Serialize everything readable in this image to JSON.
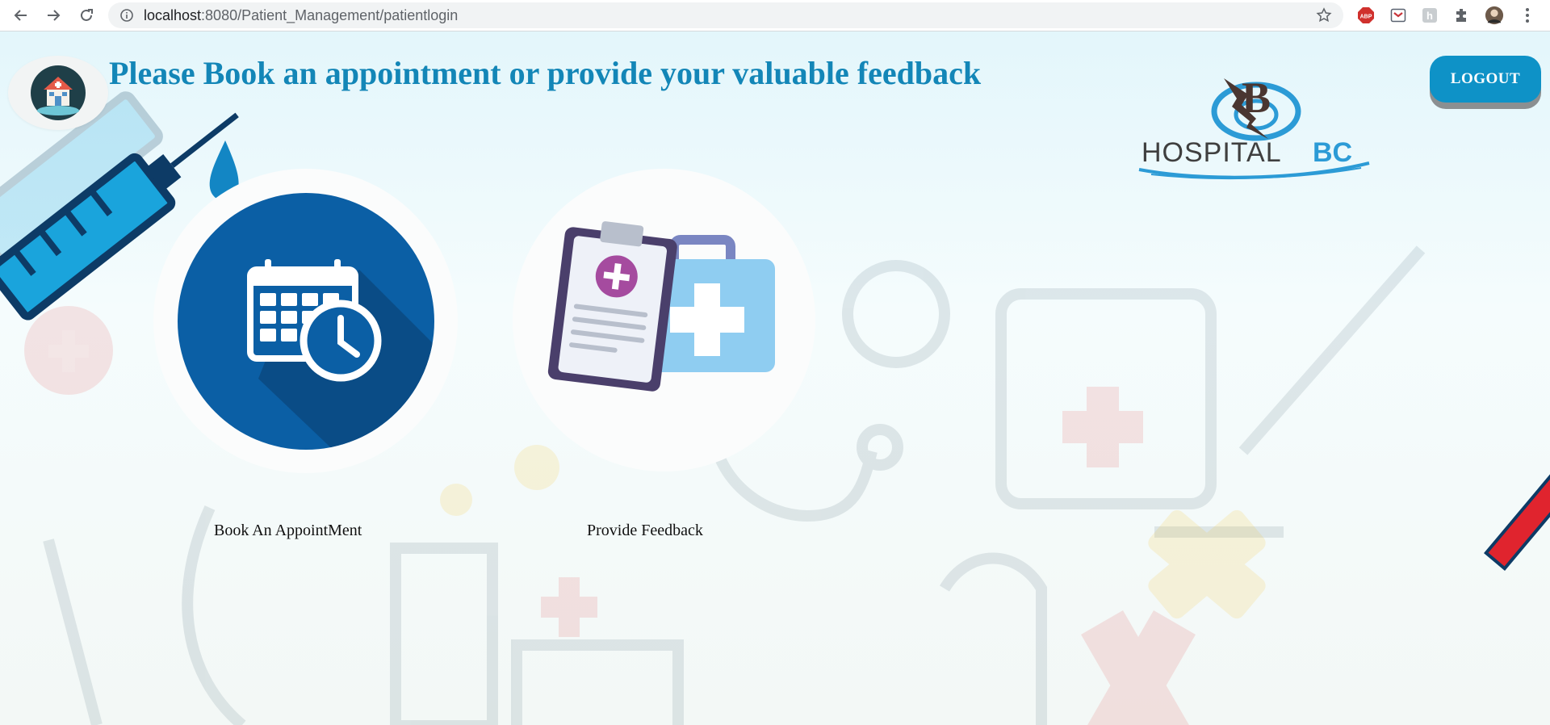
{
  "browser": {
    "url_host": "localhost",
    "url_path": ":8080/Patient_Management/patientlogin"
  },
  "header": {
    "title": "Please Book an appointment or provide your valuable feedback",
    "logout_label": "LOGOUT"
  },
  "brand": {
    "logo_text_left": "HOSPITAL",
    "logo_text_right": "BC",
    "monogram": "B"
  },
  "cards": [
    {
      "label": "Book An AppointMent",
      "icon": "calendar-clock-icon"
    },
    {
      "label": "Provide Feedback",
      "icon": "clipboard-medkit-icon"
    }
  ],
  "colors": {
    "heading": "#1386b7",
    "logout_bg": "#0e92c7",
    "appointment_circle": "#0b5fa5"
  }
}
